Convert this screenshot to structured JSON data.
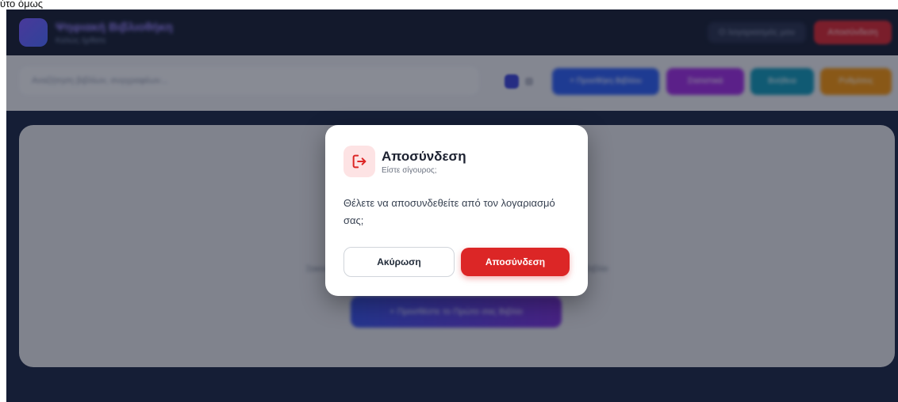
{
  "app": {
    "title": "Ψηφιακή Βιβλιοθήκη",
    "subtitle": "Καλώς ήρθατε",
    "user_label": "Ο λογαριασμός μου",
    "logout_label": "Αποσύνδεση"
  },
  "toolbar": {
    "search_placeholder": "Αναζήτηση βιβλίων, συγγραφέων...",
    "add_book_label": "+ Προσθήκη Βιβλίου",
    "stats_label": "Στατιστικά",
    "help_label": "Βοήθεια",
    "settings_label": "Ρυθμίσεις"
  },
  "main": {
    "empty_message": "Ξεκινήστε να δημιουργείτε τη συλλογή σας προσθέτοντας το πρώτο σας βιβλίο",
    "first_book_button": "+ Προσθέστε το Πρώτο σας Βιβλίο"
  },
  "modal": {
    "title": "Αποσύνδεση",
    "subtitle": "Είστε σίγουρος;",
    "message": "Θέλετε να αποσυνδεθείτε από τον λογαριασμό σας;",
    "cancel_label": "Ακύρωση",
    "confirm_label": "Αποσύνδεση",
    "icon": "logout-icon"
  },
  "colors": {
    "accent_red": "#dc2626",
    "icon_bg": "#fde3e4",
    "header_bg": "#1a2238"
  },
  "clip_label": "ύτο όμως"
}
